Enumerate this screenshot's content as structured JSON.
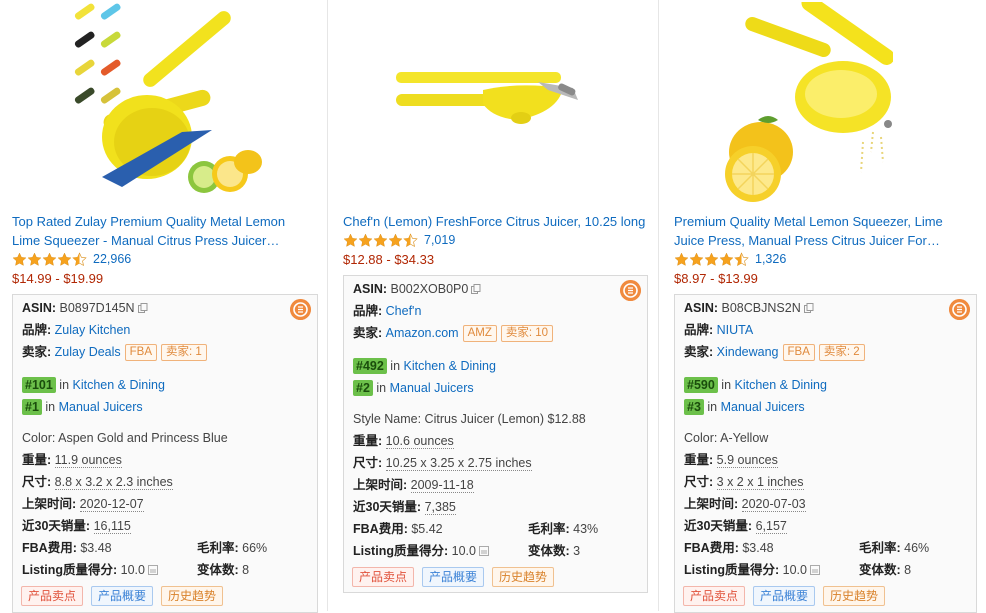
{
  "products": [
    {
      "title_line1": "Top Rated Zulay Premium Quality Metal Lemon",
      "title_line2": "Lime Squeezer - Manual Citrus Press Juicer…",
      "rating_count": "22,966",
      "price": "$14.99 - $19.99",
      "asin_label": "ASIN:",
      "asin": "B0897D145N",
      "brand_label": "品牌:",
      "brand": "Zulay Kitchen",
      "seller_label": "卖家:",
      "seller": "Zulay Deals",
      "badge1": "FBA",
      "badge2": "卖家: 1",
      "rank1": "#101",
      "rank1_in": "in",
      "rank1_cat": "Kitchen & Dining",
      "rank2": "#1",
      "rank2_in": "in",
      "rank2_cat": "Manual Juicers",
      "variant": "Color: Aspen Gold and Princess Blue",
      "weight_label": "重量:",
      "weight": "11.9 ounces",
      "size_label": "尺寸:",
      "size": "8.8 x 3.2 x 2.3 inches",
      "date_label": "上架时间:",
      "date": "2020-12-07",
      "sales_label": "近30天销量:",
      "sales": "16,115",
      "fba_label": "FBA费用:",
      "fba": "$3.48",
      "margin_label": "毛利率:",
      "margin": "66%",
      "listing_label": "Listing质量得分:",
      "listing": "10.0",
      "variants_label": "变体数:",
      "variants": "8",
      "btn1": "产品卖点",
      "btn2": "产品概要",
      "btn3": "历史趋势"
    },
    {
      "title_line1": "Chef'n (Lemon) FreshForce Citrus Juicer, 10.25 long",
      "title_line2": "",
      "rating_count": "7,019",
      "price": "$12.88 - $34.33",
      "asin_label": "ASIN:",
      "asin": "B002XOB0P0",
      "brand_label": "品牌:",
      "brand": "Chef'n",
      "seller_label": "卖家:",
      "seller": "Amazon.com",
      "badge1": "AMZ",
      "badge2": "卖家: 10",
      "rank1": "#492",
      "rank1_in": "in",
      "rank1_cat": "Kitchen & Dining",
      "rank2": "#2",
      "rank2_in": "in",
      "rank2_cat": "Manual Juicers",
      "variant": "Style Name: Citrus Juicer (Lemon) $12.88",
      "weight_label": "重量:",
      "weight": "10.6 ounces",
      "size_label": "尺寸:",
      "size": "10.25 x 3.25 x 2.75 inches",
      "date_label": "上架时间:",
      "date": "2009-11-18",
      "sales_label": "近30天销量:",
      "sales": "7,385",
      "fba_label": "FBA费用:",
      "fba": "$5.42",
      "margin_label": "毛利率:",
      "margin": "43%",
      "listing_label": "Listing质量得分:",
      "listing": "10.0",
      "variants_label": "变体数:",
      "variants": "3",
      "btn1": "产品卖点",
      "btn2": "产品概要",
      "btn3": "历史趋势"
    },
    {
      "title_line1": "Premium Quality Metal Lemon Squeezer, Lime",
      "title_line2": "Juice Press, Manual Press Citrus Juicer For…",
      "rating_count": "1,326",
      "price": "$8.97 - $13.99",
      "asin_label": "ASIN:",
      "asin": "B08CBJNS2N",
      "brand_label": "品牌:",
      "brand": "NIUTA",
      "seller_label": "卖家:",
      "seller": "Xindewang",
      "badge1": "FBA",
      "badge2": "卖家: 2",
      "rank1": "#590",
      "rank1_in": "in",
      "rank1_cat": "Kitchen & Dining",
      "rank2": "#3",
      "rank2_in": "in",
      "rank2_cat": "Manual Juicers",
      "variant": "Color: A-Yellow",
      "weight_label": "重量:",
      "weight": "5.9 ounces",
      "size_label": "尺寸:",
      "size": "3 x 2 x 1 inches",
      "date_label": "上架时间:",
      "date": "2020-07-03",
      "sales_label": "近30天销量:",
      "sales": "6,157",
      "fba_label": "FBA费用:",
      "fba": "$3.48",
      "margin_label": "毛利率:",
      "margin": "46%",
      "listing_label": "Listing质量得分:",
      "listing": "10.0",
      "variants_label": "变体数:",
      "variants": "8",
      "btn1": "产品卖点",
      "btn2": "产品概要",
      "btn3": "历史趋势"
    }
  ],
  "colors": {
    "link": "#0f6bbf",
    "price": "#b12704",
    "rank_bg": "#6cc04a",
    "star": "#f6a21e",
    "logo": "#f08a3e"
  }
}
